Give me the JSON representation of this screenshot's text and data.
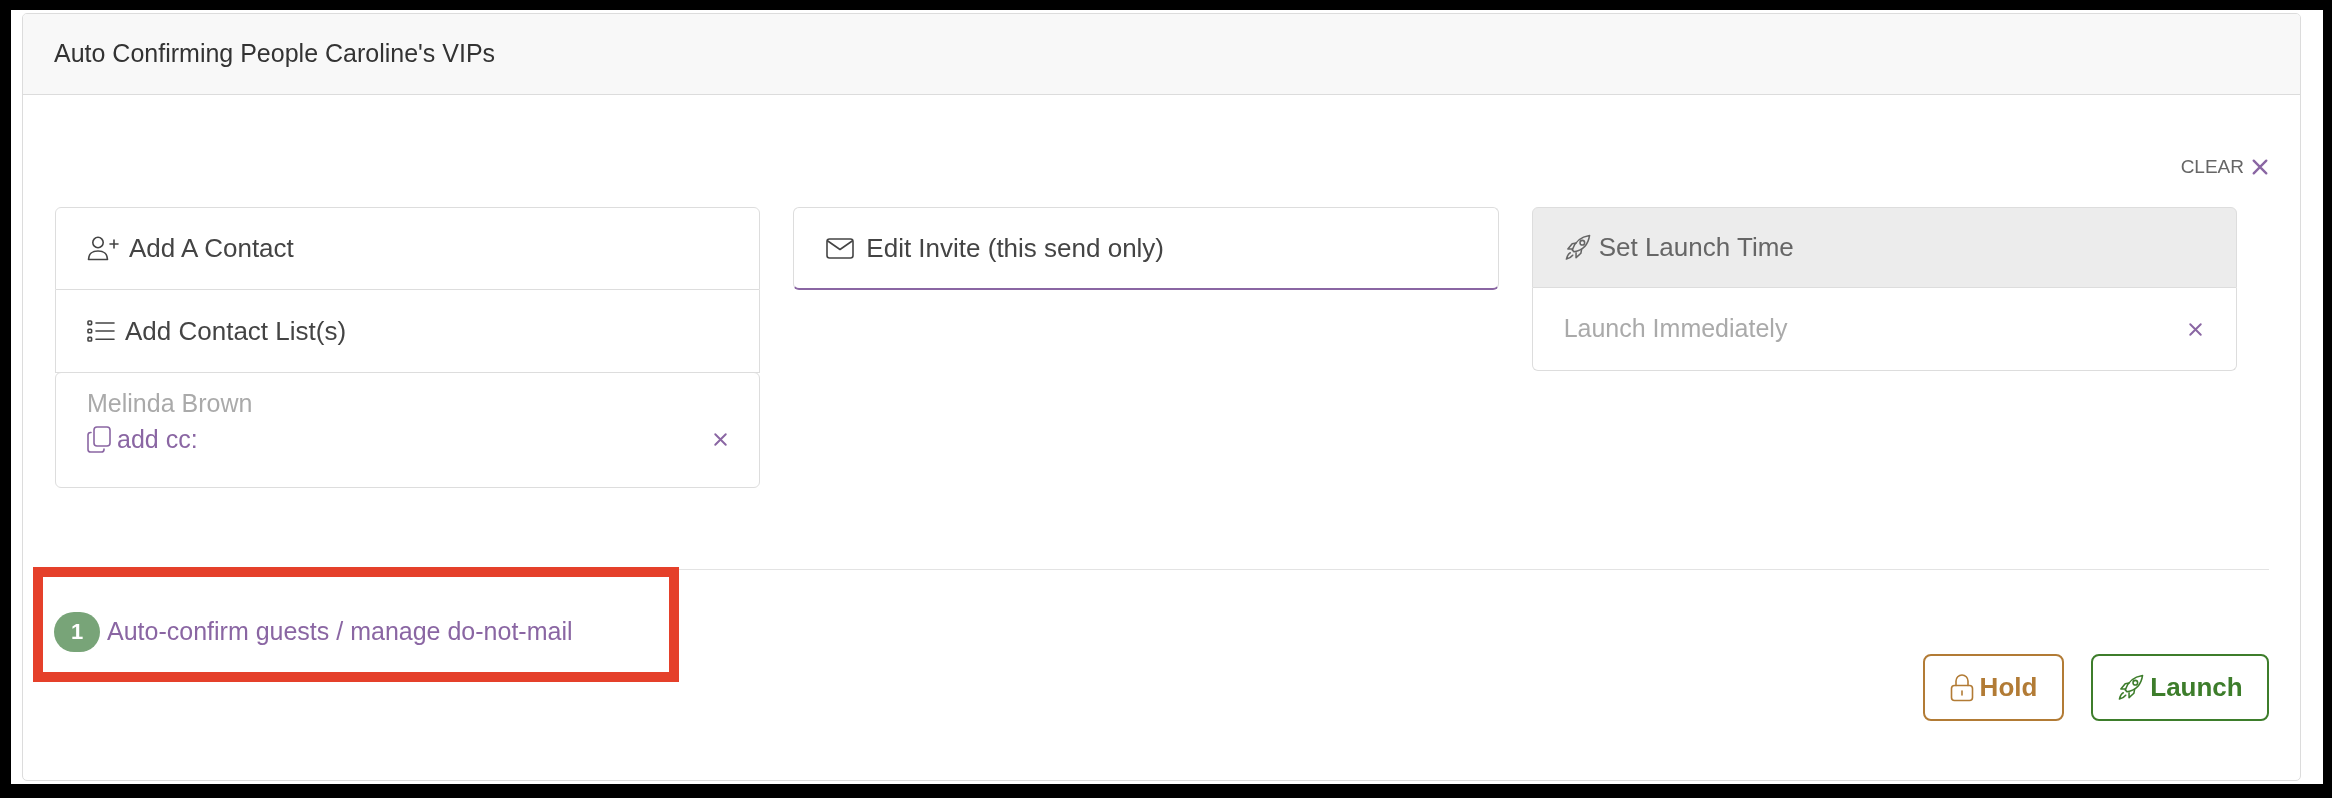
{
  "panel": {
    "title": "Auto Confirming People Caroline's VIPs"
  },
  "clear_link": {
    "label": "CLEAR"
  },
  "recipients": {
    "actions": [
      {
        "kind": "add-contact",
        "label": "Add A Contact"
      },
      {
        "kind": "add-list",
        "label": "Add Contact List(s)"
      }
    ],
    "contacts": [
      {
        "name": "Melinda Brown",
        "cc_label": "add cc:"
      }
    ]
  },
  "edit_invite": {
    "label": "Edit Invite (this send only)",
    "active": true
  },
  "launch_time": {
    "title": "Set Launch Time",
    "value": "Launch Immediately"
  },
  "auto_confirm": {
    "count": "1",
    "label": "Auto-confirm guests / manage do-not-mail",
    "highlighted": true
  },
  "buttons": [
    {
      "kind": "hold",
      "label": "Hold"
    },
    {
      "kind": "launch",
      "label": "Launch"
    }
  ]
}
